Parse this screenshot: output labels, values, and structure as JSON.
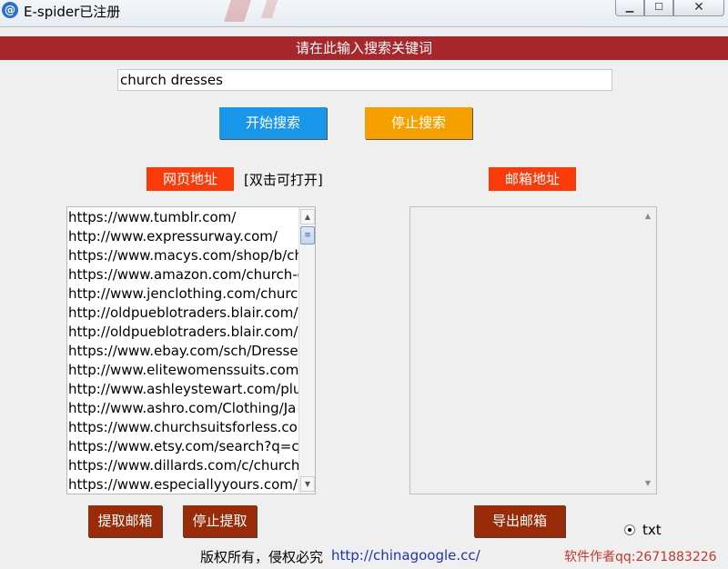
{
  "window": {
    "title": "E-spider已注册",
    "icon_glyph": "@",
    "icon": "app-at-icon",
    "controls": {
      "minimize": "▁",
      "maximize": "☐",
      "close": "✕"
    }
  },
  "header": {
    "text": "请在此输入搜索关键词"
  },
  "search": {
    "value": "church dresses"
  },
  "buttons": {
    "start_search": "开始搜索",
    "stop_search": "停止搜索",
    "extract_email": "提取邮箱",
    "stop_extract": "停止提取",
    "export_email": "导出邮箱"
  },
  "labels": {
    "url_label": "网页地址",
    "dblclick_hint": "[双击可打开]",
    "email_label": "邮箱地址",
    "txt_option": "txt"
  },
  "url_list": [
    "https://www.tumblr.com/",
    "http://www.expressurway.com/",
    "https://www.macys.com/shop/b/church-dresses",
    "https://www.amazon.com/church-dresses",
    "http://www.jenclothing.com/church-dresses",
    "http://oldpueblotraders.blair.com/",
    "http://oldpueblotraders.blair.com/",
    "https://www.ebay.com/sch/Dresses",
    "http://www.elitewomenssuits.com/",
    "http://www.ashleystewart.com/plus",
    "http://www.ashro.com/Clothing/Ja",
    "https://www.churchsuitsforless.com",
    "https://www.etsy.com/search?q=church",
    "https://www.dillards.com/c/church",
    "https://www.especiallyyours.com/c"
  ],
  "email_list": [],
  "footer": {
    "copyright": "版权所有，侵权必究",
    "link": "http://chinagoogle.cc/",
    "author": "软件作者qq:2671883226"
  },
  "colors": {
    "header_bg": "#a7282c",
    "start_search_bg": "#1896ea",
    "stop_search_bg": "#f6a000",
    "tag_bg": "#fb3a0a",
    "brown_button_bg": "#9a2b08",
    "link_color": "#1a35b8",
    "author_color": "#c0392b"
  }
}
